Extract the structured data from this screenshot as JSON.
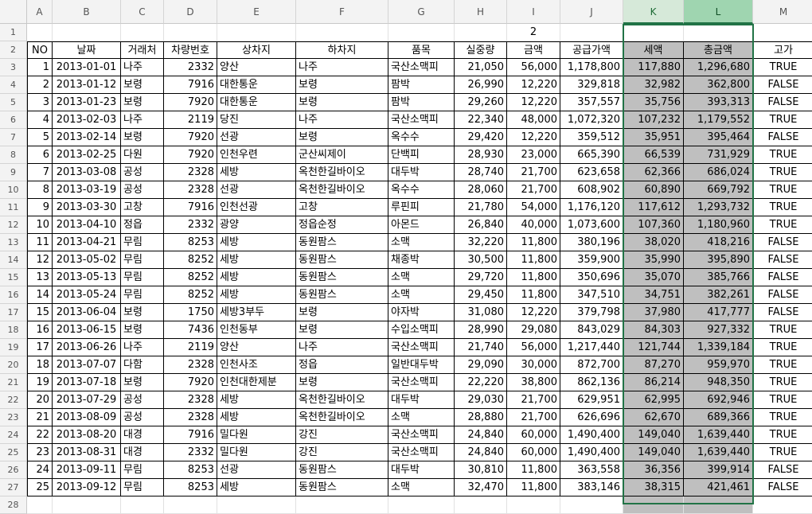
{
  "columns": [
    "A",
    "B",
    "C",
    "D",
    "E",
    "F",
    "G",
    "H",
    "I",
    "J",
    "K",
    "L",
    "M"
  ],
  "row_numbers": [
    "1",
    "2",
    "3",
    "4",
    "5",
    "6",
    "7",
    "8",
    "9",
    "10",
    "11",
    "12",
    "13",
    "14",
    "15",
    "16",
    "17",
    "18",
    "19",
    "20",
    "21",
    "22",
    "23",
    "24",
    "25",
    "26",
    "27",
    "28"
  ],
  "row1_value": "2",
  "headers": [
    "NO",
    "날짜",
    "거래처",
    "차량번호",
    "상차지",
    "하차지",
    "품목",
    "실중량",
    "금액",
    "공급가액",
    "세액",
    "총금액",
    "고가"
  ],
  "rows": [
    [
      "1",
      "2013-01-01",
      "나주",
      "2332",
      "양산",
      "나주",
      "국산소맥피",
      "21,050",
      "56,000",
      "1,178,800",
      "117,880",
      "1,296,680",
      "TRUE"
    ],
    [
      "2",
      "2013-01-12",
      "보령",
      "7916",
      "대한통운",
      "보령",
      "팜박",
      "26,990",
      "12,220",
      "329,818",
      "32,982",
      "362,800",
      "FALSE"
    ],
    [
      "3",
      "2013-01-23",
      "보령",
      "7920",
      "대한통운",
      "보령",
      "팜박",
      "29,260",
      "12,220",
      "357,557",
      "35,756",
      "393,313",
      "FALSE"
    ],
    [
      "4",
      "2013-02-03",
      "나주",
      "2119",
      "당진",
      "나주",
      "국산소맥피",
      "22,340",
      "48,000",
      "1,072,320",
      "107,232",
      "1,179,552",
      "TRUE"
    ],
    [
      "5",
      "2013-02-14",
      "보령",
      "7920",
      "선광",
      "보령",
      "옥수수",
      "29,420",
      "12,220",
      "359,512",
      "35,951",
      "395,464",
      "FALSE"
    ],
    [
      "6",
      "2013-02-25",
      "다원",
      "7920",
      "인천우련",
      "군산씨제이",
      "단백피",
      "28,930",
      "23,000",
      "665,390",
      "66,539",
      "731,929",
      "TRUE"
    ],
    [
      "7",
      "2013-03-08",
      "공성",
      "2328",
      "세방",
      "옥천한길바이오",
      "대두박",
      "28,740",
      "21,700",
      "623,658",
      "62,366",
      "686,024",
      "TRUE"
    ],
    [
      "8",
      "2013-03-19",
      "공성",
      "2328",
      "선광",
      "옥천한길바이오",
      "옥수수",
      "28,060",
      "21,700",
      "608,902",
      "60,890",
      "669,792",
      "TRUE"
    ],
    [
      "9",
      "2013-03-30",
      "고창",
      "7916",
      "인천선광",
      "고창",
      "루핀피",
      "21,780",
      "54,000",
      "1,176,120",
      "117,612",
      "1,293,732",
      "TRUE"
    ],
    [
      "10",
      "2013-04-10",
      "정읍",
      "2332",
      "광양",
      "정읍순정",
      "아몬드",
      "26,840",
      "40,000",
      "1,073,600",
      "107,360",
      "1,180,960",
      "TRUE"
    ],
    [
      "11",
      "2013-04-21",
      "무림",
      "8253",
      "세방",
      "동원팜스",
      "소맥",
      "32,220",
      "11,800",
      "380,196",
      "38,020",
      "418,216",
      "FALSE"
    ],
    [
      "12",
      "2013-05-02",
      "무림",
      "8252",
      "세방",
      "동원팜스",
      "채종박",
      "30,500",
      "11,800",
      "359,900",
      "35,990",
      "395,890",
      "FALSE"
    ],
    [
      "13",
      "2013-05-13",
      "무림",
      "8252",
      "세방",
      "동원팜스",
      "소맥",
      "29,720",
      "11,800",
      "350,696",
      "35,070",
      "385,766",
      "FALSE"
    ],
    [
      "14",
      "2013-05-24",
      "무림",
      "8252",
      "세방",
      "동원팜스",
      "소맥",
      "29,450",
      "11,800",
      "347,510",
      "34,751",
      "382,261",
      "FALSE"
    ],
    [
      "15",
      "2013-06-04",
      "보령",
      "1750",
      "세방3부두",
      "보령",
      "야자박",
      "31,080",
      "12,220",
      "379,798",
      "37,980",
      "417,777",
      "FALSE"
    ],
    [
      "16",
      "2013-06-15",
      "보령",
      "7436",
      "인천동부",
      "보령",
      "수입소맥피",
      "28,990",
      "29,080",
      "843,029",
      "84,303",
      "927,332",
      "TRUE"
    ],
    [
      "17",
      "2013-06-26",
      "나주",
      "2119",
      "양산",
      "나주",
      "국산소맥피",
      "21,740",
      "56,000",
      "1,217,440",
      "121,744",
      "1,339,184",
      "TRUE"
    ],
    [
      "18",
      "2013-07-07",
      "다함",
      "2328",
      "인천사조",
      "정읍",
      "일반대두박",
      "29,090",
      "30,000",
      "872,700",
      "87,270",
      "959,970",
      "TRUE"
    ],
    [
      "19",
      "2013-07-18",
      "보령",
      "7920",
      "인천대한제분",
      "보령",
      "국산소맥피",
      "22,220",
      "38,800",
      "862,136",
      "86,214",
      "948,350",
      "TRUE"
    ],
    [
      "20",
      "2013-07-29",
      "공성",
      "2328",
      "세방",
      "옥천한길바이오",
      "대두박",
      "29,030",
      "21,700",
      "629,951",
      "62,995",
      "692,946",
      "TRUE"
    ],
    [
      "21",
      "2013-08-09",
      "공성",
      "2328",
      "세방",
      "옥천한길바이오",
      "소맥",
      "28,880",
      "21,700",
      "626,696",
      "62,670",
      "689,366",
      "TRUE"
    ],
    [
      "22",
      "2013-08-20",
      "대경",
      "7916",
      "밀다원",
      "강진",
      "국산소맥피",
      "24,840",
      "60,000",
      "1,490,400",
      "149,040",
      "1,639,440",
      "TRUE"
    ],
    [
      "23",
      "2013-08-31",
      "대경",
      "2332",
      "밀다원",
      "강진",
      "국산소맥피",
      "24,840",
      "60,000",
      "1,490,400",
      "149,040",
      "1,639,440",
      "TRUE"
    ],
    [
      "24",
      "2013-09-11",
      "무림",
      "8253",
      "선광",
      "동원팜스",
      "대두박",
      "30,810",
      "11,800",
      "363,558",
      "36,356",
      "399,914",
      "FALSE"
    ],
    [
      "25",
      "2013-09-12",
      "무림",
      "8253",
      "세방",
      "동원팜스",
      "소맥",
      "32,470",
      "11,800",
      "383,146",
      "38,315",
      "421,461",
      "FALSE"
    ]
  ],
  "colors": {
    "selection": "#217346",
    "shade": "#bfbfbf",
    "header_bg": "#f3f3f3"
  }
}
